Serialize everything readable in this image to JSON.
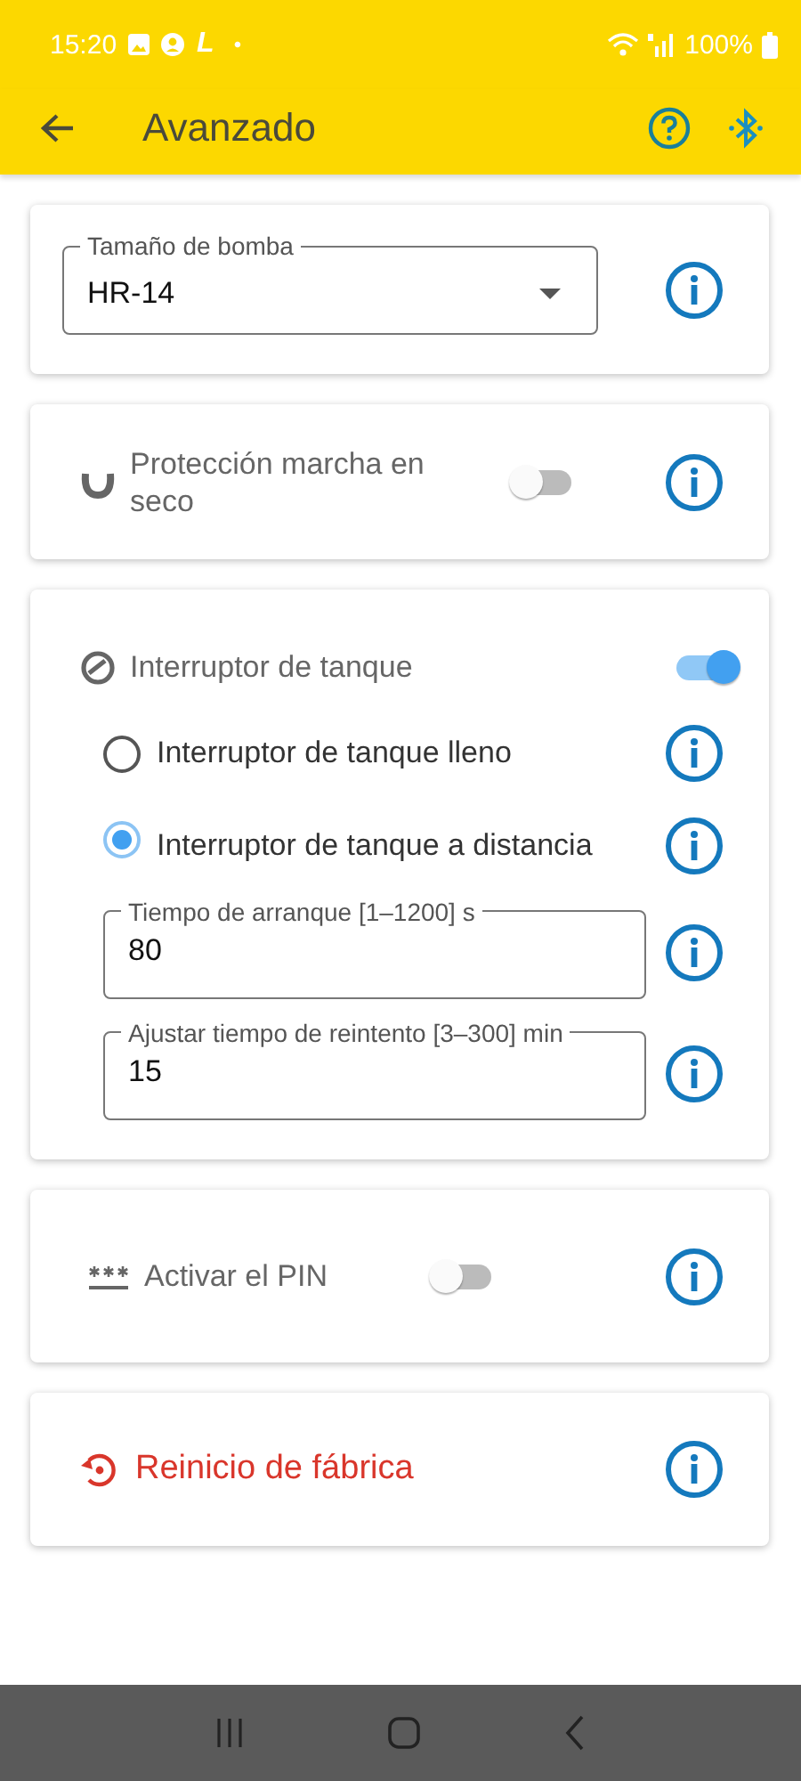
{
  "status_bar": {
    "time": "15:20",
    "app_glyph": "L",
    "more_glyph": "•",
    "battery": "100%"
  },
  "app_bar": {
    "title": "Avanzado"
  },
  "pump_size": {
    "label": "Tamaño de bomba",
    "value": "HR-14"
  },
  "dry_run": {
    "label": "Protección marcha en seco",
    "on": false
  },
  "tank_switch": {
    "label": "Interruptor de tanque",
    "on": true,
    "options": [
      {
        "label": "Interruptor de tanque lleno",
        "selected": false
      },
      {
        "label": "Interruptor de tanque a distancia",
        "selected": true
      }
    ],
    "fields": [
      {
        "label": "Tiempo de arranque [1–1200] s",
        "value": "80"
      },
      {
        "label": "Ajustar tiempo de reintento [3–300] min",
        "value": "15"
      }
    ]
  },
  "pin": {
    "label": "Activar el PIN",
    "on": false
  },
  "factory_reset": {
    "label": "Reinicio de fábrica"
  }
}
